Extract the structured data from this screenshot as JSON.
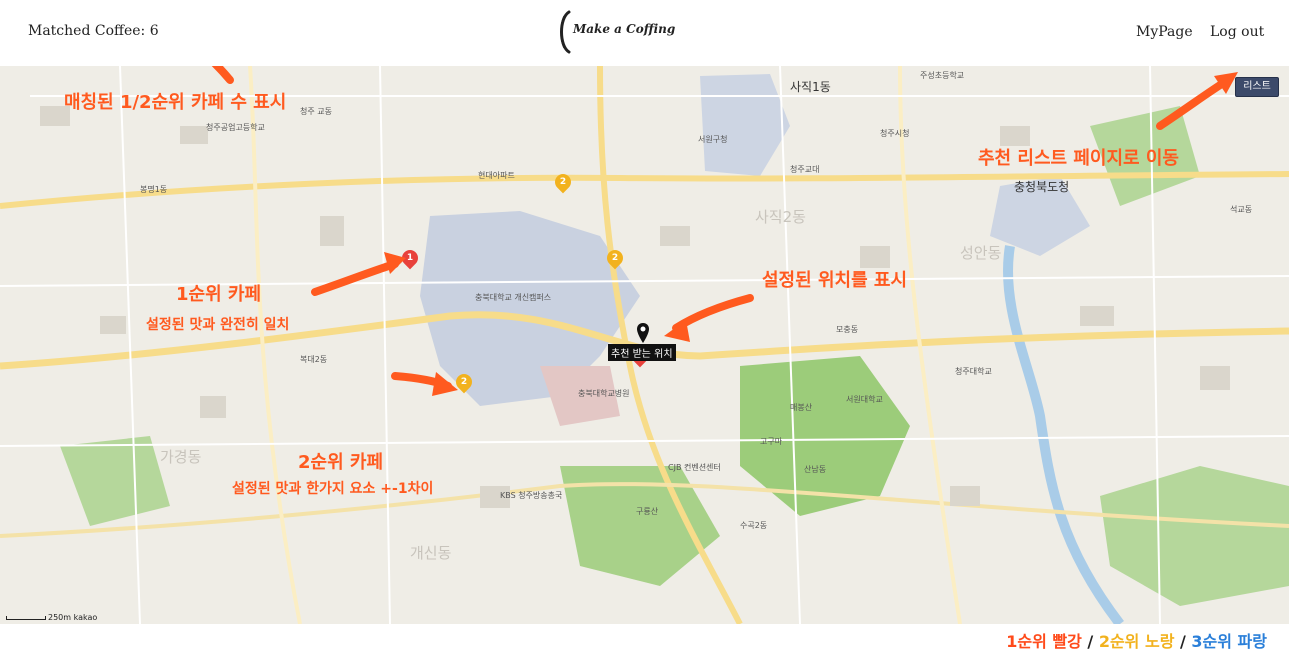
{
  "header": {
    "matched_label": "Matched Coffee:",
    "matched_count": "6",
    "logo_text": "Make a Coffing",
    "nav": {
      "mypage": "MyPage",
      "logout": "Log out"
    }
  },
  "map": {
    "list_button": "리스트",
    "scale_text": "250m",
    "attribution": "kakao",
    "current_location_label": "추천 받는 위치",
    "markers": [
      {
        "rank": "1",
        "color": "#e8413b"
      },
      {
        "rank": "2",
        "color": "#f2b21e"
      },
      {
        "rank": "2",
        "color": "#f2b21e"
      },
      {
        "rank": "2",
        "color": "#f2b21e"
      },
      {
        "rank": "1",
        "color": "#e8413b"
      }
    ],
    "labels": {
      "l1": "사직1동",
      "l2": "청주 교동",
      "l3": "서원구청",
      "l4": "충청북도청",
      "l5": "사직2동",
      "l6": "청주대학교",
      "l7": "충북대학교 개신캠퍼스",
      "l8": "구룡산",
      "l9": "KBS 청주방송총국",
      "l10": "CJB 컨벤션센터",
      "l11": "매봉산",
      "l12": "충북대학교병원",
      "l13": "청주시청",
      "l14": "가경동",
      "l15": "개신동",
      "l16": "모충동",
      "l17": "서원대학교",
      "l18": "고구마",
      "l19": "수곡2동",
      "l20": "청주교대",
      "l21": "석교동",
      "l22": "성안동",
      "l23": "주성초등학교",
      "l24": "현대아파트",
      "l25": "산남동",
      "l26": "복대2동",
      "l27": "봉명1동",
      "l28": "청주공업고등학교"
    }
  },
  "annotations": {
    "a_matched": "매칭된 1/2순위 카페 수 표시",
    "a_list": "추천 리스트 페이지로 이동",
    "a_rank1": "1순위 카페",
    "a_rank1_sub": "설정된 맛과 완전히 일치",
    "a_location": "설정된 위치를 표시",
    "a_rank2": "2순위 카페",
    "a_rank2_sub": "설정된 맛과 한가지 요소 +-1차이"
  },
  "legend": {
    "rank1": "1순위 빨강",
    "sep1": " / ",
    "rank2": "2순위 노랑",
    "sep2": " / ",
    "rank3": "3순위 파랑",
    "colors": {
      "rank1": "#ff4a1a",
      "rank2": "#f2b21e",
      "rank3": "#2a7fd9"
    }
  },
  "colors": {
    "annotation": "#ff5a1f",
    "list_button": "#3c4a6a",
    "map_background": "#efede6",
    "road": "#f7dc8a",
    "park": "#8fc76a",
    "campus": "#c9d1e0"
  }
}
